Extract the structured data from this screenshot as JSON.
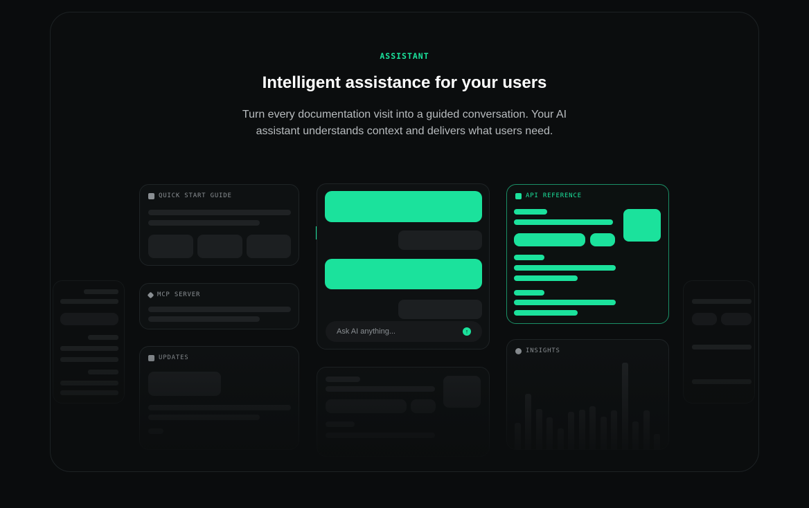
{
  "header": {
    "eyebrow": "ASSISTANT",
    "title": "Intelligent assistance for your users",
    "subtitle": "Turn every documentation visit into a guided conversation. Your AI assistant understands context and delivers what users need."
  },
  "cards": {
    "quick_start": "QUICK START GUIDE",
    "mcp_server": "MCP SERVER",
    "updates": "UPDATES",
    "api_reference": "API REFERENCE",
    "insights": "INSIGHTS"
  },
  "chat": {
    "placeholder": "Ask AI anything...",
    "send_icon": "arrow-up-icon"
  },
  "colors": {
    "accent": "#1be29c",
    "background": "#0a0c0d"
  }
}
